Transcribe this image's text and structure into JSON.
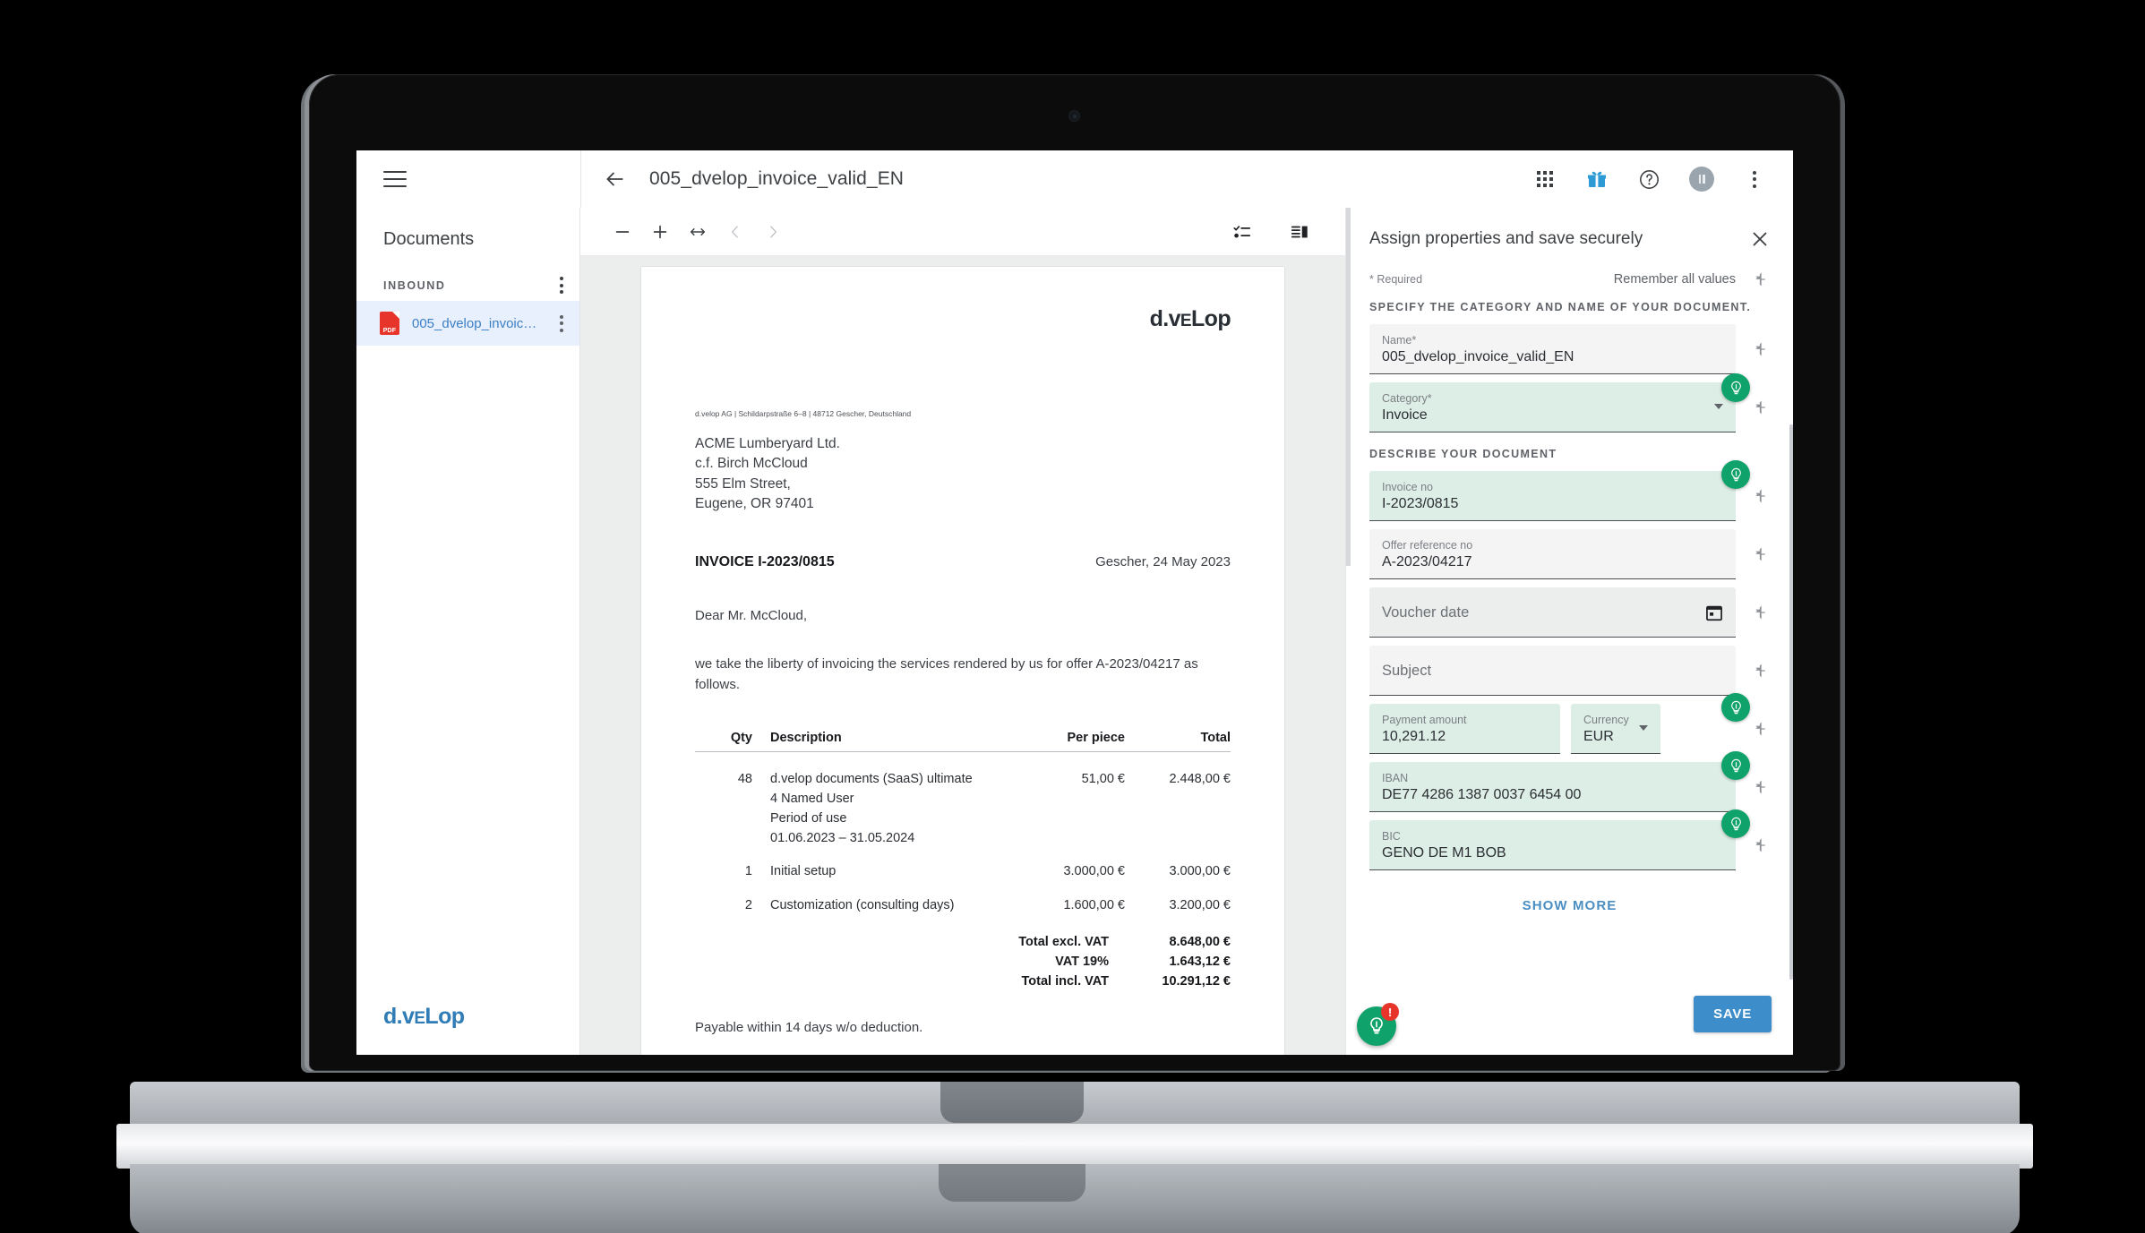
{
  "topbar": {
    "menu_icon": "hamburger-icon",
    "back_icon": "arrow-left-icon",
    "document_title": "005_dvelop_invoice_valid_EN",
    "icons": [
      "apps-grid-icon",
      "gift-icon",
      "help-circle-icon",
      "avatar-icon",
      "more-vertical-icon"
    ]
  },
  "sidebar": {
    "title": "Documents",
    "section_label": "INBOUND",
    "items": [
      {
        "label": "005_dvelop_invoic…",
        "file_type": "PDF",
        "selected": true
      }
    ],
    "footer_logo": "d.veLop"
  },
  "viewer": {
    "toolbar": {
      "zoom_out": "minus-icon",
      "zoom_in": "plus-icon",
      "fit_width": "fit-width-icon",
      "prev_page": "chevron-left-icon",
      "next_page": "chevron-right-icon",
      "checklist": "checklist-icon",
      "layout": "panel-layout-icon"
    }
  },
  "invoice": {
    "logo": "d.veLop",
    "sender_line": "d.velop AG | Schildarpstraße 6–8 | 48712 Gescher, Deutschland",
    "recipient": [
      "ACME Lumberyard Ltd.",
      "c.f. Birch McCloud",
      "555 Elm Street,",
      "Eugene, OR 97401"
    ],
    "invoice_heading": "INVOICE I-2023/0815",
    "place_date": "Gescher, 24 May 2023",
    "greeting": "Dear Mr. McCloud,",
    "intro": "we take the liberty of invoicing the services rendered by us for offer A-2023/04217 as follows.",
    "table": {
      "headers": [
        "Qty",
        "Description",
        "Per piece",
        "Total"
      ],
      "rows": [
        {
          "qty": "48",
          "description": "d.velop documents (SaaS) ultimate\n4 Named User\nPeriod of use\n01.06.2023 – 31.05.2024",
          "per_piece": "51,00 €",
          "total": "2.448,00 €"
        },
        {
          "qty": "1",
          "description": "Initial setup",
          "per_piece": "3.000,00 €",
          "total": "3.000,00 €"
        },
        {
          "qty": "2",
          "description": "Customization (consulting days)",
          "per_piece": "1.600,00 €",
          "total": "3.200,00 €"
        }
      ]
    },
    "totals": [
      {
        "label": "Total excl. VAT",
        "value": "8.648,00 €"
      },
      {
        "label": "VAT 19%",
        "value": "1.643,12 €"
      },
      {
        "label": "Total incl. VAT",
        "value": "10.291,12 €"
      }
    ],
    "footer_note": "Payable within 14 days w/o deduction."
  },
  "properties": {
    "title": "Assign properties and save securely",
    "close_icon": "close-icon",
    "required_note": "* Required",
    "remember_all": "Remember all values",
    "section_1": "SPECIFY THE CATEGORY AND NAME OF YOUR DOCUMENT.",
    "section_2": "DESCRIBE YOUR DOCUMENT",
    "fields": {
      "name": {
        "label": "Name*",
        "value": "005_dvelop_invoice_valid_EN",
        "highlight": false
      },
      "category": {
        "label": "Category*",
        "value": "Invoice",
        "highlight": true
      },
      "invoice_no": {
        "label": "Invoice no",
        "value": "I-2023/0815",
        "highlight": true
      },
      "offer_reference_no": {
        "label": "Offer reference no",
        "value": "A-2023/04217",
        "highlight": false
      },
      "voucher_date": {
        "label": "",
        "placeholder": "Voucher date",
        "value": "",
        "highlight": false
      },
      "subject": {
        "label": "",
        "placeholder": "Subject",
        "value": "",
        "highlight": false
      },
      "payment_amount": {
        "label": "Payment amount",
        "value": "10,291.12",
        "highlight": true
      },
      "currency": {
        "label": "Currency",
        "value": "EUR",
        "highlight": true
      },
      "iban": {
        "label": "IBAN",
        "value": "DE77 4286 1387 0037 6454 00",
        "highlight": true
      },
      "bic": {
        "label": "BIC",
        "value": "GENO DE M1 BOB",
        "highlight": true
      }
    },
    "show_more": "SHOW MORE",
    "save_label": "SAVE",
    "fab": {
      "icon": "lightbulb-icon",
      "badge": "!"
    },
    "pin_icon": "pushpin-icon",
    "colors": {
      "highlight_green": "#ddeee6",
      "accent_green": "#0fa36b",
      "save_blue": "#3c8dc9",
      "link_blue": "#4a8ec2",
      "badge_red": "#e8352c"
    }
  }
}
